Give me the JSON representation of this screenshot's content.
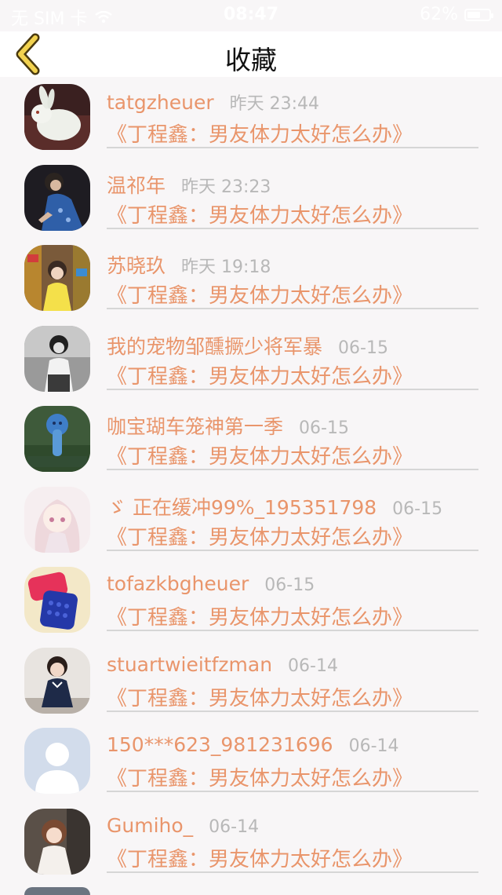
{
  "status_bar": {
    "carrier": "无 SIM 卡",
    "time": "08:47",
    "battery_percent": "62%",
    "battery_level": 0.62
  },
  "nav": {
    "title": "收藏",
    "back_icon": "chevron-left-icon"
  },
  "colors": {
    "accent": "#e9956b",
    "time_gray": "#b8b8b8",
    "back_icon": "#f2d24f",
    "divider": "#d6d6d6"
  },
  "favorites": [
    {
      "name": "tatgzheuer",
      "time": "昨天 23:44",
      "title": "《丁程鑫：男友体力太好怎么办》",
      "avatar": "white-jade-rabbit"
    },
    {
      "name": "温祁年",
      "time": "昨天 23:23",
      "title": "《丁程鑫：男友体力太好怎么办》",
      "avatar": "girl-blue-dress"
    },
    {
      "name": "苏晓玖",
      "time": "昨天 19:18",
      "title": "《丁程鑫：男友体力太好怎么办》",
      "avatar": "girl-store-shelves"
    },
    {
      "name": "我的宠物邹醺撅少将军暴",
      "time": "06-15",
      "title": "《丁程鑫：男友体力太好怎么办》",
      "avatar": "boy-black-white"
    },
    {
      "name": "咖宝瑚车笼神第一季",
      "time": "06-15",
      "title": "《丁程鑫：男友体力太好怎么办》",
      "avatar": "blue-mushroom"
    },
    {
      "name": "ゞ 正在缓冲99%_195351798",
      "time": "06-15",
      "title": "《丁程鑫：男友体力太好怎么办》",
      "avatar": "anime-girl"
    },
    {
      "name": "tofazkbgheuer",
      "time": "06-15",
      "title": "《丁程鑫：男友体力太好怎么办》",
      "avatar": "phone-cases"
    },
    {
      "name": "stuartwieitfzman",
      "time": "06-14",
      "title": "《丁程鑫：男友体力太好怎么办》",
      "avatar": "toddler-navy-dress"
    },
    {
      "name": "150***623_981231696",
      "time": "06-14",
      "title": "《丁程鑫：男友体力太好怎么办》",
      "avatar": "default-avatar"
    },
    {
      "name": "Gumiho_",
      "time": "06-14",
      "title": "《丁程鑫：男友体力太好怎么办》",
      "avatar": "girl-portrait"
    }
  ]
}
